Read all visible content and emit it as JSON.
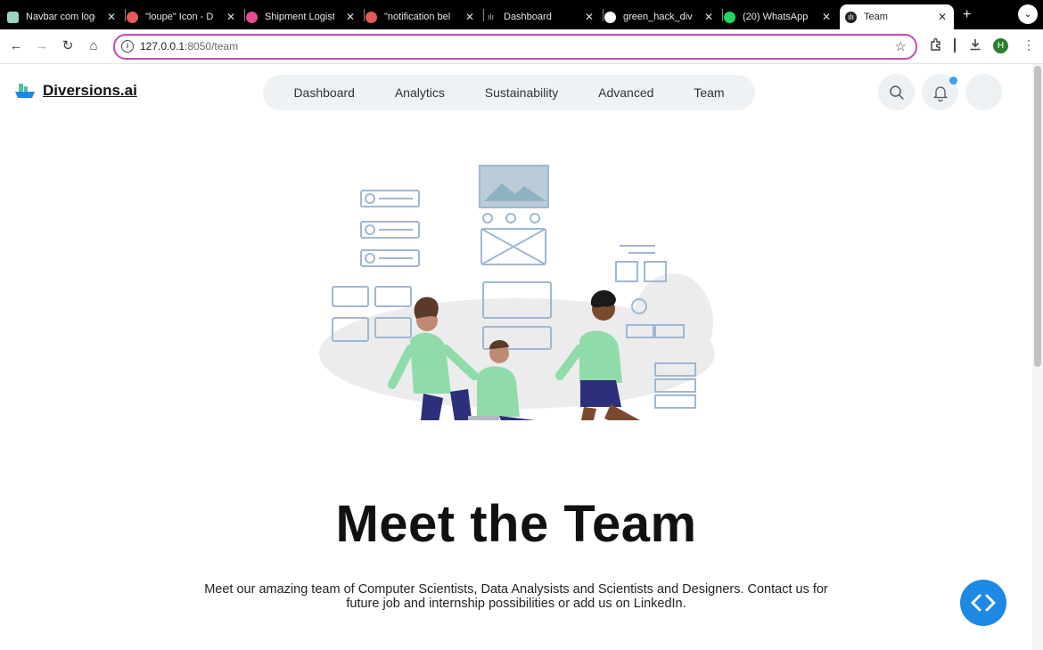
{
  "browser": {
    "tabs": [
      {
        "title": "Navbar com logo",
        "favicon": "navbar-favicon"
      },
      {
        "title": "\"loupe\" Icon - D",
        "favicon": "icon-site-favicon"
      },
      {
        "title": "Shipment Logist",
        "favicon": "dribbble-favicon"
      },
      {
        "title": "\"notification bel",
        "favicon": "icon-site-favicon"
      },
      {
        "title": "Dashboard",
        "favicon": "app-favicon"
      },
      {
        "title": "green_hack_dive",
        "favicon": "github-favicon"
      },
      {
        "title": "(20) WhatsApp",
        "favicon": "whatsapp-favicon"
      },
      {
        "title": "Team",
        "favicon": "app-favicon"
      }
    ],
    "url_host": "127.0.0.1",
    "url_path": ":8050/team",
    "profile_initial": "H"
  },
  "navbar": {
    "brand": "Diversions.ai",
    "items": [
      {
        "label": "Dashboard"
      },
      {
        "label": "Analytics"
      },
      {
        "label": "Sustainability"
      },
      {
        "label": "Advanced"
      },
      {
        "label": "Team"
      }
    ],
    "has_notification": true
  },
  "main": {
    "heading": "Meet the Team",
    "description_line1": "Meet our amazing team of Computer Scientists, Data Analysists and Scientists and Designers. Contact us for",
    "description_line2": "future job and internship possibilities or add us on LinkedIn."
  },
  "colors": {
    "accent": "#1e88e5",
    "notification": "#3b9ff2",
    "nav_bg": "#eef2f4",
    "illustration_green": "#8fdcaa",
    "illustration_navy": "#2c2f7a"
  }
}
